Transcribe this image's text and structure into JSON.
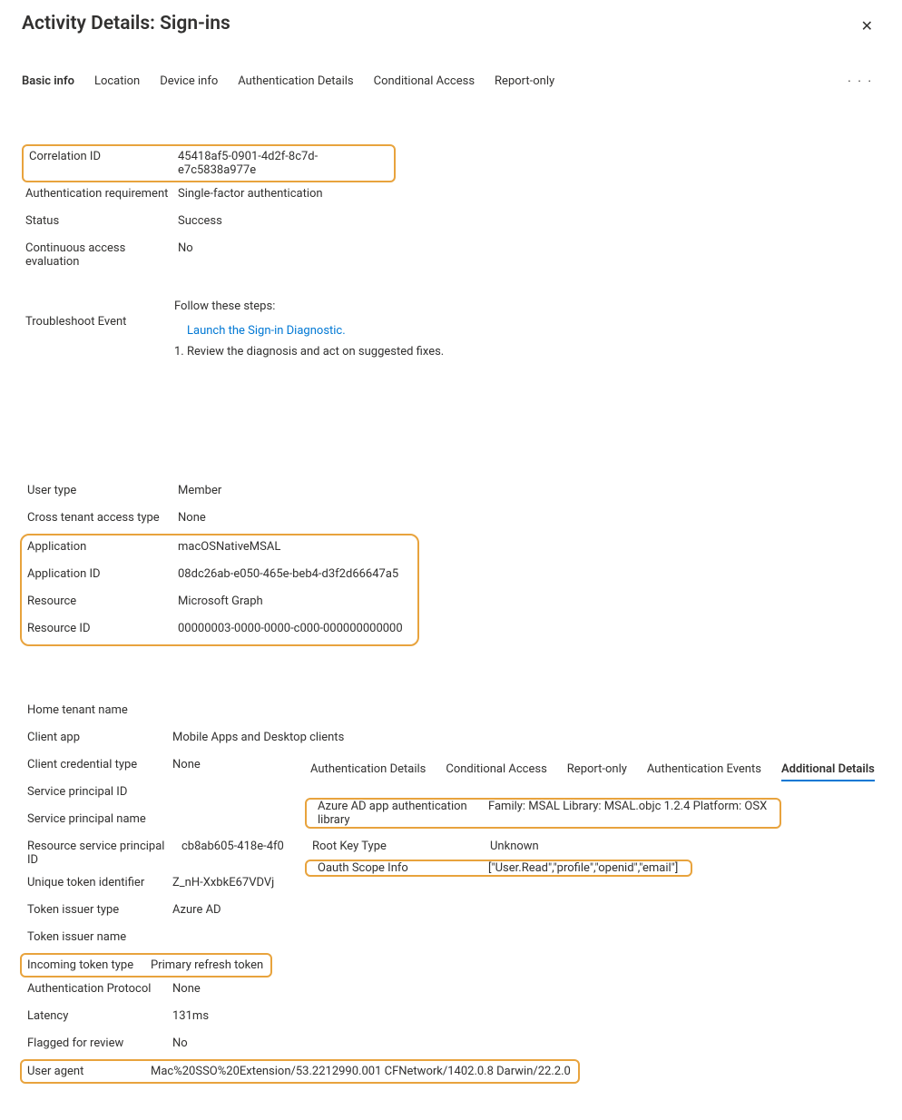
{
  "header": {
    "title": "Activity Details: Sign-ins"
  },
  "tabs": {
    "basic_info": "Basic info",
    "location": "Location",
    "device_info": "Device info",
    "auth_details": "Authentication Details",
    "conditional_access": "Conditional Access",
    "report_only": "Report-only",
    "more": "· · ·"
  },
  "correlation": {
    "label": "Correlation ID",
    "value": "45418af5-0901-4d2f-8c7d-e7c5838a977e"
  },
  "auth_requirement": {
    "label": "Authentication requirement",
    "value": "Single-factor authentication"
  },
  "status": {
    "label": "Status",
    "value": "Success"
  },
  "cae": {
    "label": "Continuous access evaluation",
    "value": "No"
  },
  "troubleshoot": {
    "label": "Troubleshoot Event",
    "intro": "Follow these steps:",
    "link": "Launch the Sign-in Diagnostic.",
    "step1": "1. Review the diagnosis and act on suggested fixes."
  },
  "user_type": {
    "label": "User type",
    "value": "Member"
  },
  "cross_tenant": {
    "label": "Cross tenant access type",
    "value": "None"
  },
  "application": {
    "label": "Application",
    "value": "macOSNativeMSAL"
  },
  "application_id": {
    "label": "Application ID",
    "value": "08dc26ab-e050-465e-beb4-d3f2d66647a5"
  },
  "resource": {
    "label": "Resource",
    "value": "Microsoft Graph"
  },
  "resource_id": {
    "label": "Resource ID",
    "value": "00000003-0000-0000-c000-000000000000"
  },
  "home_tenant_name": {
    "label": "Home tenant name",
    "value": ""
  },
  "client_app": {
    "label": "Client app",
    "value": "Mobile Apps and Desktop clients"
  },
  "client_cred_type": {
    "label": "Client credential type",
    "value": "None"
  },
  "service_principal_id": {
    "label": "Service principal ID",
    "value": ""
  },
  "service_principal_name": {
    "label": "Service principal name",
    "value": ""
  },
  "resource_sp_id": {
    "label": "Resource service principal ID",
    "value": "cb8ab605-418e-4f0"
  },
  "unique_token_id": {
    "label": "Unique token identifier",
    "value": "Z_nH-XxbkE67VDVj"
  },
  "token_issuer_type": {
    "label": "Token issuer type",
    "value": "Azure AD"
  },
  "token_issuer_name": {
    "label": "Token issuer name",
    "value": ""
  },
  "incoming_token_type": {
    "label": "Incoming token type",
    "value": "Primary refresh token"
  },
  "auth_protocol": {
    "label": "Authentication Protocol",
    "value": "None"
  },
  "latency": {
    "label": "Latency",
    "value": "131ms"
  },
  "flagged": {
    "label": "Flagged for review",
    "value": "No"
  },
  "user_agent": {
    "label": "User agent",
    "value": "Mac%20SSO%20Extension/53.2212990.001 CFNetwork/1402.0.8 Darwin/22.2.0"
  },
  "rp_tabs": {
    "auth_details": "Authentication Details",
    "conditional_access": "Conditional Access",
    "report_only": "Report-only",
    "auth_events": "Authentication Events",
    "additional_details": "Additional Details"
  },
  "auth_library": {
    "label": "Azure AD app authentication library",
    "value": "Family: MSAL Library: MSAL.objc 1.2.4 Platform: OSX"
  },
  "root_key_type": {
    "label": "Root Key Type",
    "value": "Unknown"
  },
  "oauth_scope": {
    "label": "Oauth Scope Info",
    "value": "[\"User.Read\",\"profile\",\"openid\",\"email\"]"
  }
}
